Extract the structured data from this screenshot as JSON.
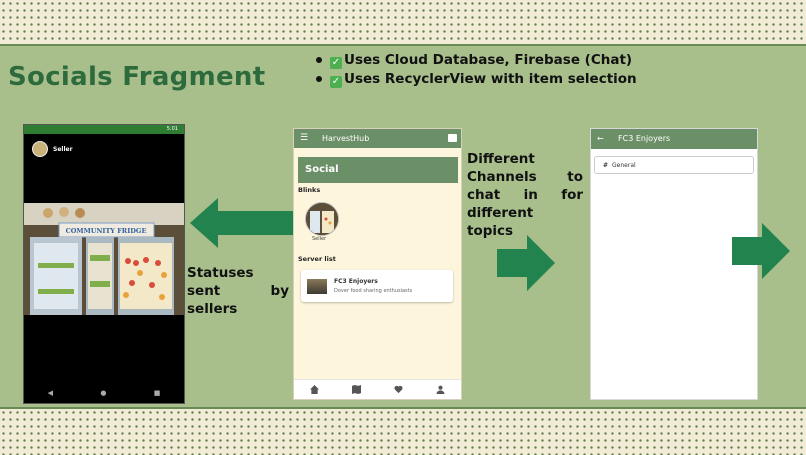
{
  "slide": {
    "title": "Socials Fragment",
    "bullets": [
      {
        "check": "✓",
        "text": "Uses Cloud Database, Firebase (Chat)"
      },
      {
        "check": "✓",
        "text": "Uses RecyclerView with item selection"
      }
    ],
    "caption_statuses": "Statuses sent by sellers",
    "caption_channels": "Different Channels to chat in for different topics",
    "colors": {
      "accent": "#2d6b3d",
      "arrow": "#22834f",
      "background": "#a8bf8c",
      "appbar": "#6b8f67"
    }
  },
  "status_screen": {
    "status_time": "5:01",
    "user_name": "Seller",
    "photo_sign": "COMMUNITY FRIDGE",
    "nav": {
      "back": "◀",
      "home": "●",
      "recents": "■"
    }
  },
  "social_screen": {
    "app_name": "HarvestHub",
    "menu_icon": "menu-icon",
    "chat_icon": "chat-icon",
    "section_title": "Social",
    "blinks_label": "Blinks",
    "blink_user": "Seller",
    "server_list_label": "Server list",
    "servers": [
      {
        "name": "FC3 Enjoyers",
        "description": "Dover food sharing enthusiasts"
      }
    ],
    "nav": [
      "home-icon",
      "map-icon",
      "heart-icon",
      "person-icon"
    ]
  },
  "channel_screen": {
    "title": "FC3 Enjoyers",
    "channels": [
      {
        "name": "General"
      }
    ]
  }
}
